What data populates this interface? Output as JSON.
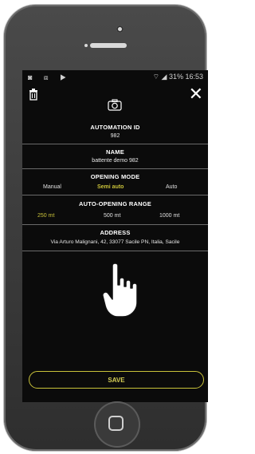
{
  "status_bar": {
    "left_icons": "◙ ⧈ ▶",
    "right_text": "31% 16:53"
  },
  "form": {
    "automation_id": {
      "label": "AUTOMATION ID",
      "value": "982"
    },
    "name": {
      "label": "NAME",
      "value": "battente demo 982"
    },
    "opening_mode": {
      "label": "OPENING MODE",
      "options": [
        "Manual",
        "Semi auto",
        "Auto"
      ],
      "selected": "Semi auto"
    },
    "auto_opening_range": {
      "label": "AUTO-OPENING RANGE",
      "options": [
        "250 mt",
        "500 mt",
        "1000 mt"
      ],
      "selected": "250 mt"
    },
    "address": {
      "label": "ADDRESS",
      "value": "Via Arturo Malignani, 42, 33077 Sacile PN, Italia, Sacile"
    }
  },
  "actions": {
    "save_label": "SAVE"
  },
  "colors": {
    "accent": "#c9c23a",
    "background": "#0b0b0b"
  }
}
